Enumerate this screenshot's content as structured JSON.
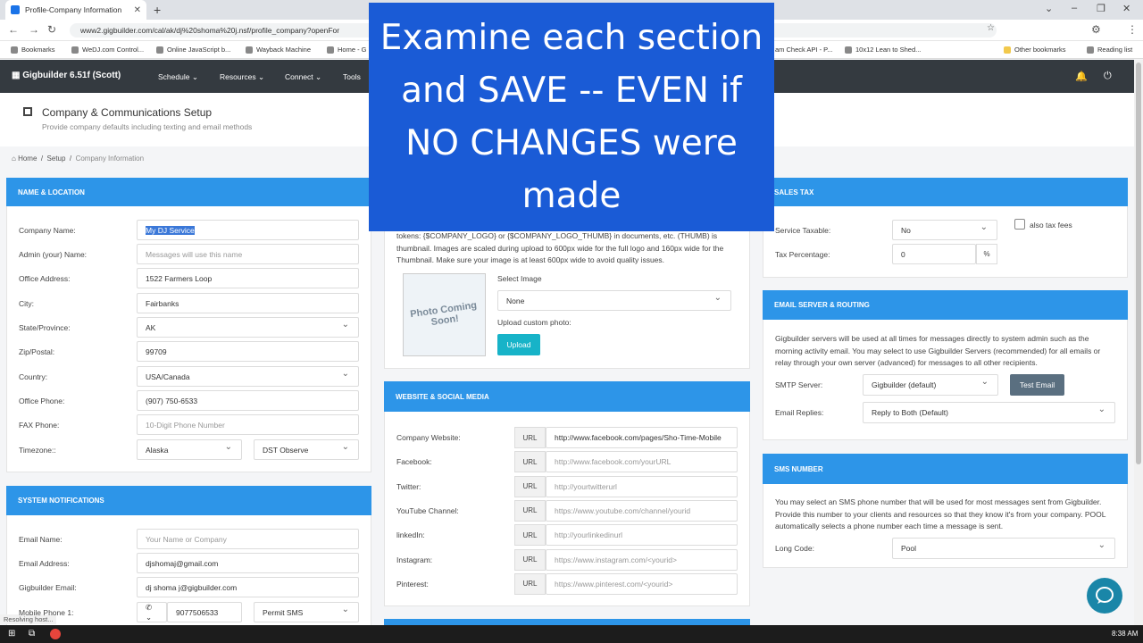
{
  "browser": {
    "tab_title": "Profile-Company Information",
    "url": "www2.gigbuilder.com/cal/ak/dj%20shoma%20j.nsf/profile_company?openFor",
    "bookmarks": [
      "Bookmarks",
      "WeDJ.com Control...",
      "Online JavaScript b...",
      "Wayback Machine",
      "Home - G",
      "am Check API - P...",
      "10x12 Lean to Shed...",
      "Other bookmarks",
      "Reading list"
    ],
    "status": "Resolving host..."
  },
  "app": {
    "brand": "Gigbuilder 6.51f (Scott)",
    "menu": [
      "Schedule",
      "Resources",
      "Connect",
      "Tools"
    ]
  },
  "header": {
    "title": "Company & Communications Setup",
    "subtitle": "Provide company defaults including texting and email methods",
    "crumbs": [
      "Home",
      "Setup",
      "Company Information"
    ]
  },
  "overlay": "Examine each section and SAVE -- EVEN if NO CHANGES were made",
  "name_location": {
    "title": "NAME & LOCATION",
    "fields": [
      {
        "label": "Company Name:",
        "value": "My DJ Service"
      },
      {
        "label": "Admin (your) Name:",
        "placeholder": "Messages will use this name"
      },
      {
        "label": "Office Address:",
        "value": "1522 Farmers Loop"
      },
      {
        "label": "City:",
        "value": "Fairbanks"
      },
      {
        "label": "State/Province:",
        "value": "AK"
      },
      {
        "label": "Zip/Postal:",
        "value": "99709"
      },
      {
        "label": "Country:",
        "value": "USA/Canada"
      },
      {
        "label": "Office Phone:",
        "value": "(907) 750-6533"
      },
      {
        "label": "FAX Phone:",
        "placeholder": "10-Digit Phone Number"
      },
      {
        "label": "Timezone::",
        "value": "Alaska",
        "value2": "DST Observe"
      }
    ]
  },
  "notifications": {
    "title": "SYSTEM NOTIFICATIONS",
    "fields": [
      {
        "label": "Email Name:",
        "placeholder": "Your Name or Company"
      },
      {
        "label": "Email Address:",
        "value": "djshomaj@gmail.com"
      },
      {
        "label": "Gigbuilder Email:",
        "value": "dj shoma j@gigbuilder.com"
      },
      {
        "label": "Mobile Phone 1:",
        "value": "9077506533",
        "value2": "Permit SMS"
      }
    ]
  },
  "logo": {
    "text": "tokens: {$COMPANY_LOGO} or {$COMPANY_LOGO_THUMB} in documents, etc. (THUMB) is thumbnail. Images are scaled during upload to 600px wide for the full logo and 160px wide for the Thumbnail. Make sure your image is at least 600px wide to avoid quality issues.",
    "select_label": "Select Image",
    "select_value": "None",
    "upload_label": "Upload custom photo:",
    "upload_btn": "Upload",
    "photo_text": "Photo Coming Soon!"
  },
  "website": {
    "title": "WEBSITE & SOCIAL MEDIA",
    "prefix": "URL",
    "fields": [
      {
        "label": "Company Website:",
        "value": "http://www.facebook.com/pages/Sho-Time-Mobile"
      },
      {
        "label": "Facebook:",
        "placeholder": "http://www.facebook.com/yourURL"
      },
      {
        "label": "Twitter:",
        "placeholder": "http://yourtwitterurl"
      },
      {
        "label": "YouTube Channel:",
        "placeholder": "https://www.youtube.com/channel/yourid"
      },
      {
        "label": "linkedIn:",
        "placeholder": "http://yourlinkedinurl"
      },
      {
        "label": "Instagram:",
        "placeholder": "https://www.instagram.com/<yourid>"
      },
      {
        "label": "Pinterest:",
        "placeholder": "https://www.pinterest.com/<yourid>"
      }
    ]
  },
  "sales_tax": {
    "title": "SALES TAX",
    "taxable_label": "Service Taxable:",
    "taxable_value": "No",
    "also_label": "also tax fees",
    "pct_label": "Tax Percentage:",
    "pct_value": "0",
    "pct_unit": "%"
  },
  "email_server": {
    "title": "EMAIL SERVER & ROUTING",
    "text": "Gigbuilder servers will be used at all times for messages directly to system admin such as the morning activity email. You may select to use Gigbuilder Servers (recommended) for all emails or relay through your own server (advanced) for messages to all other recipients.",
    "smtp_label": "SMTP Server:",
    "smtp_value": "Gigbuilder (default)",
    "test_btn": "Test Email",
    "replies_label": "Email Replies:",
    "replies_value": "Reply to Both (Default)"
  },
  "sms": {
    "title": "SMS NUMBER",
    "text": "You may select an SMS phone number that will be used for most messages sent from Gigbuilder. Provide this number to your clients and resources so that they know it's from your company. POOL automatically selects a phone number each time a message is sent.",
    "long_label": "Long Code:",
    "long_value": "Pool"
  },
  "taskbar": {
    "time": "8:38 AM"
  }
}
